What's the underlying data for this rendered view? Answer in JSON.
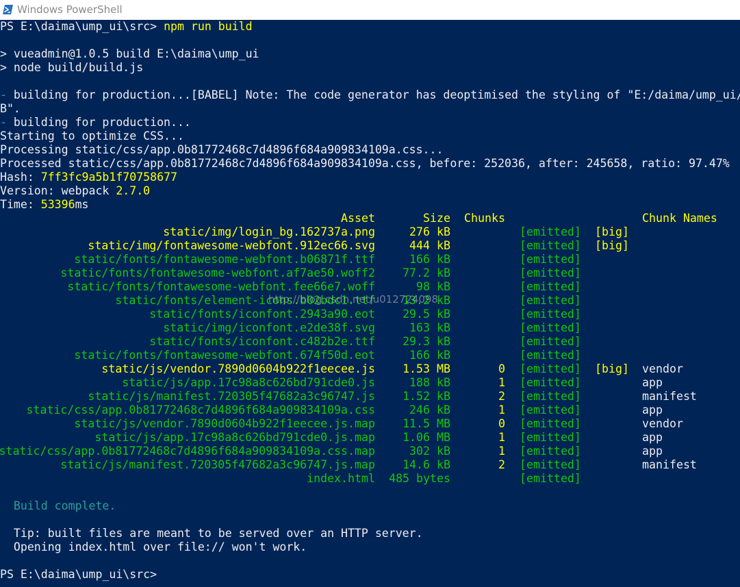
{
  "window": {
    "title": "Windows PowerShell",
    "icon": "powershell-icon"
  },
  "colors": {
    "console_bg": "#012456",
    "text": "#eeedf0",
    "yellow": "#ffff00",
    "green": "#16c60c",
    "spinner": "#3a96dd",
    "build_complete": "#2aa198"
  },
  "terminal": {
    "prompt1": {
      "prompt": "PS E:\\daima\\ump_ui\\src>",
      "command": "npm run build"
    },
    "npm1": "> vueadmin@1.0.5 build E:\\daima\\ump_ui",
    "npm2": "> node build/build.js",
    "spin1_mark": "-",
    "spin1_text": " building for production...[BABEL] Note: The code generator has deoptimised the styling of \"E:/daima/ump_ui/",
    "spin1_cont": "B\".",
    "spin2_mark": "-",
    "spin2_text": " building for production...",
    "optimize": "Starting to optimize CSS...",
    "processing": "Processing static/css/app.0b81772468c7d4896f684a909834109a.css...",
    "processed": "Processed static/css/app.0b81772468c7d4896f684a909834109a.css, before: 252036, after: 245658, ratio: 97.47%",
    "hash_label": "Hash: ",
    "hash_value": "7ff3fc9a5b1f70758677",
    "version_label": "Version: webpack ",
    "version_value": "2.7.0",
    "time_label": "Time: ",
    "time_value": "53396",
    "time_unit": "ms",
    "table": {
      "headers": {
        "asset": "Asset",
        "size": "Size",
        "chunks": "Chunks",
        "chunk_names": "Chunk Names"
      },
      "rows": [
        {
          "asset": "static/img/login_bg.162737a.png",
          "size": "276 kB",
          "chunk": "",
          "status": "[emitted]",
          "flag": "[big]",
          "name": "",
          "big": true
        },
        {
          "asset": "static/img/fontawesome-webfont.912ec66.svg",
          "size": "444 kB",
          "chunk": "",
          "status": "[emitted]",
          "flag": "[big]",
          "name": "",
          "big": true
        },
        {
          "asset": "static/fonts/fontawesome-webfont.b06871f.ttf",
          "size": "166 kB",
          "chunk": "",
          "status": "[emitted]",
          "flag": "",
          "name": "",
          "big": false
        },
        {
          "asset": "static/fonts/fontawesome-webfont.af7ae50.woff2",
          "size": "77.2 kB",
          "chunk": "",
          "status": "[emitted]",
          "flag": "",
          "name": "",
          "big": false
        },
        {
          "asset": "static/fonts/fontawesome-webfont.fee66e7.woff",
          "size": "98 kB",
          "chunk": "",
          "status": "[emitted]",
          "flag": "",
          "name": "",
          "big": false
        },
        {
          "asset": "static/fonts/element-icons.b02bdc1.ttf",
          "size": "13.2 kB",
          "chunk": "",
          "status": "[emitted]",
          "flag": "",
          "name": "",
          "big": false
        },
        {
          "asset": "static/fonts/iconfont.2943a90.eot",
          "size": "29.5 kB",
          "chunk": "",
          "status": "[emitted]",
          "flag": "",
          "name": "",
          "big": false
        },
        {
          "asset": "static/img/iconfont.e2de38f.svg",
          "size": "163 kB",
          "chunk": "",
          "status": "[emitted]",
          "flag": "",
          "name": "",
          "big": false
        },
        {
          "asset": "static/fonts/iconfont.c482b2e.ttf",
          "size": "29.3 kB",
          "chunk": "",
          "status": "[emitted]",
          "flag": "",
          "name": "",
          "big": false
        },
        {
          "asset": "static/fonts/fontawesome-webfont.674f50d.eot",
          "size": "166 kB",
          "chunk": "",
          "status": "[emitted]",
          "flag": "",
          "name": "",
          "big": false
        },
        {
          "asset": "static/js/vendor.7890d0604b922f1eecee.js",
          "size": "1.53 MB",
          "chunk": "0",
          "status": "[emitted]",
          "flag": "[big]",
          "name": "vendor",
          "big": true
        },
        {
          "asset": "static/js/app.17c98a8c626bd791cde0.js",
          "size": "188 kB",
          "chunk": "1",
          "status": "[emitted]",
          "flag": "",
          "name": "app",
          "big": false
        },
        {
          "asset": "static/js/manifest.720305f47682a3c96747.js",
          "size": "1.52 kB",
          "chunk": "2",
          "status": "[emitted]",
          "flag": "",
          "name": "manifest",
          "big": false
        },
        {
          "asset": "static/css/app.0b81772468c7d4896f684a909834109a.css",
          "size": "246 kB",
          "chunk": "1",
          "status": "[emitted]",
          "flag": "",
          "name": "app",
          "big": false
        },
        {
          "asset": "static/js/vendor.7890d0604b922f1eecee.js.map",
          "size": "11.5 MB",
          "chunk": "0",
          "status": "[emitted]",
          "flag": "",
          "name": "vendor",
          "big": false
        },
        {
          "asset": "static/js/app.17c98a8c626bd791cde0.js.map",
          "size": "1.06 MB",
          "chunk": "1",
          "status": "[emitted]",
          "flag": "",
          "name": "app",
          "big": false
        },
        {
          "asset": "static/css/app.0b81772468c7d4896f684a909834109a.css.map",
          "size": "302 kB",
          "chunk": "1",
          "status": "[emitted]",
          "flag": "",
          "name": "app",
          "big": false
        },
        {
          "asset": "static/js/manifest.720305f47682a3c96747.js.map",
          "size": "14.6 kB",
          "chunk": "2",
          "status": "[emitted]",
          "flag": "",
          "name": "manifest",
          "big": false
        },
        {
          "asset": "index.html",
          "size": "485 bytes",
          "chunk": "",
          "status": "[emitted]",
          "flag": "",
          "name": "",
          "big": false
        }
      ]
    },
    "build_complete": "  Build complete.",
    "tip1": "  Tip: built files are meant to be served over an HTTP server.",
    "tip2": "  Opening index.html over file:// won't work.",
    "prompt2": "PS E:\\daima\\ump_ui\\src>",
    "watermark": "http://blog.csdn.net/u012724098"
  }
}
